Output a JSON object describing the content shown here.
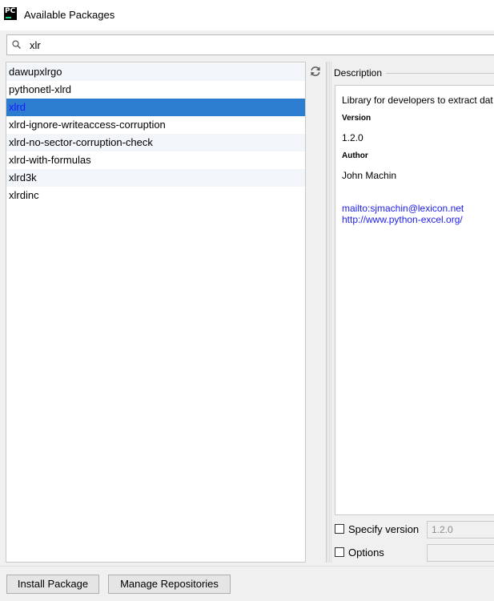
{
  "window": {
    "title": "Available Packages",
    "app_icon_text": "PC"
  },
  "search": {
    "value": "xlr"
  },
  "packages": [
    "dawupxlrgo",
    "pythonetl-xlrd",
    "xlrd",
    "xlrd-ignore-writeaccess-corruption",
    "xlrd-no-sector-corruption-check",
    "xlrd-with-formulas",
    "xlrd3k",
    "xlrdinc"
  ],
  "selected_package": "xlrd",
  "description": {
    "header": "Description",
    "summary": "Library for developers to extract dat",
    "version_label": "Version",
    "version": "1.2.0",
    "author_label": "Author",
    "author": "John Machin",
    "email_link": "mailto:sjmachin@lexicon.net",
    "homepage_link": "http://www.python-excel.org/"
  },
  "options": {
    "specify_version_label": "Specify version",
    "specify_version_value": "1.2.0",
    "options_label": "Options",
    "options_value": ""
  },
  "buttons": {
    "install": "Install Package",
    "manage_repos": "Manage Repositories"
  },
  "colors": {
    "selection_bg": "#2c7cd0",
    "selection_text": "#1a1aff",
    "link": "#2020ee",
    "alt_row": "#f2f5fa"
  },
  "icons": [
    "pycharm-icon",
    "search-icon",
    "refresh-icon"
  ]
}
